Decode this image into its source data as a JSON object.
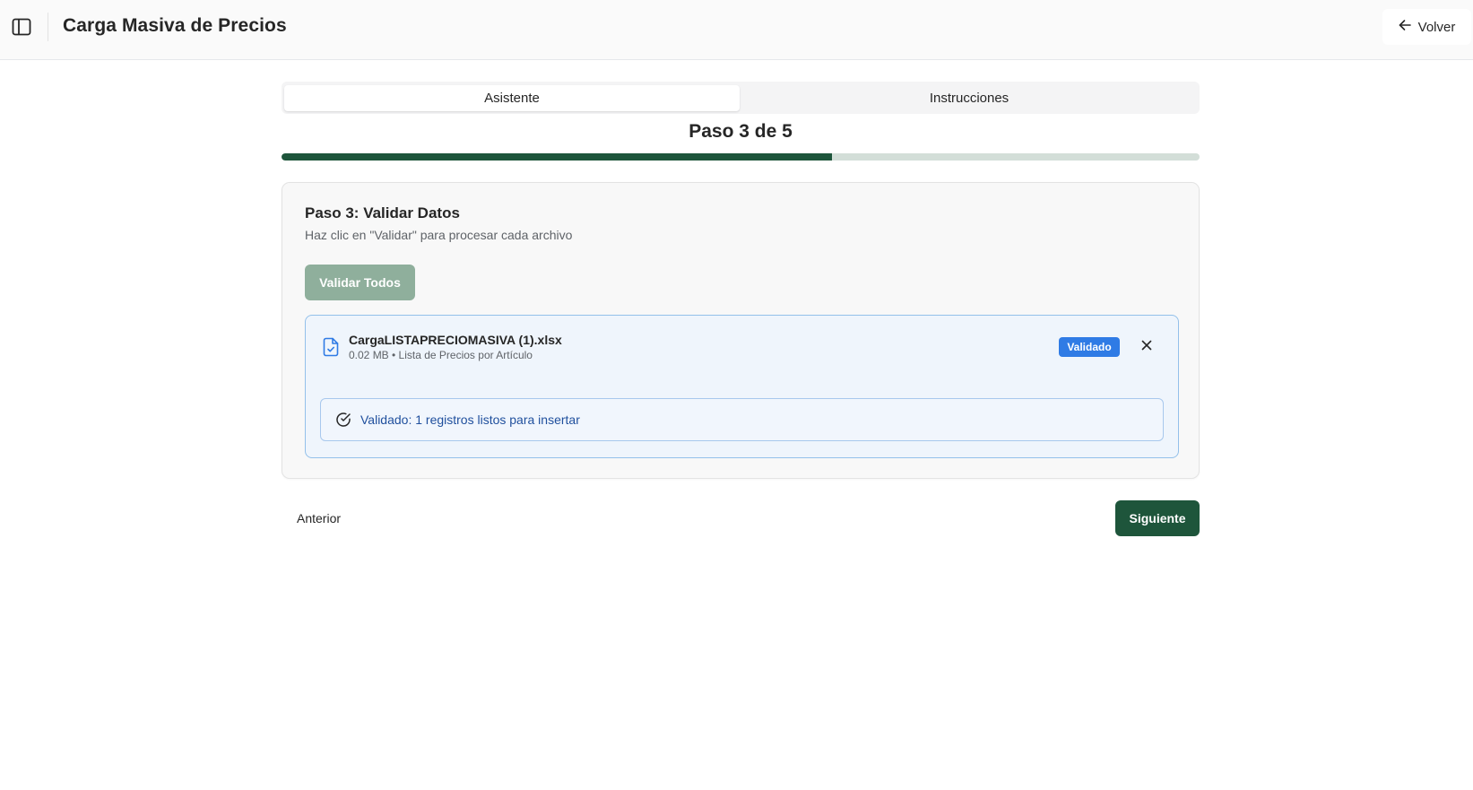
{
  "header": {
    "title": "Carga Masiva de Precios",
    "back_label": "Volver",
    "sidebar_icon": "sidebar-toggle-icon",
    "back_icon": "arrow-left-icon"
  },
  "tabs": [
    {
      "label": "Asistente",
      "active": true
    },
    {
      "label": "Instrucciones",
      "active": false
    }
  ],
  "wizard": {
    "step_label": "Paso 3 de 5",
    "current_step": 3,
    "total_steps": 5,
    "progress_fraction": 0.6
  },
  "card": {
    "title": "Paso 3: Validar Datos",
    "subtitle": "Haz clic en \"Validar\" para procesar cada archivo",
    "validate_all_label": "Validar Todos"
  },
  "file": {
    "name": "CargaLISTAPRECIOMASIVA (1).xlsx",
    "meta": "0.02 MB • Lista de Precios por Artículo",
    "status": "Validado",
    "icon": "file-check-icon",
    "validation_message": "Validado: 1 registros listos para insertar"
  },
  "navigation": {
    "prev_label": "Anterior",
    "next_label": "Siguiente"
  },
  "colors": {
    "primary": "#1e553b",
    "primary_disabled": "#8faf9c",
    "progress_track": "#d3ded8",
    "badge": "#2f7be5",
    "alert_text": "#1f4f9d"
  }
}
